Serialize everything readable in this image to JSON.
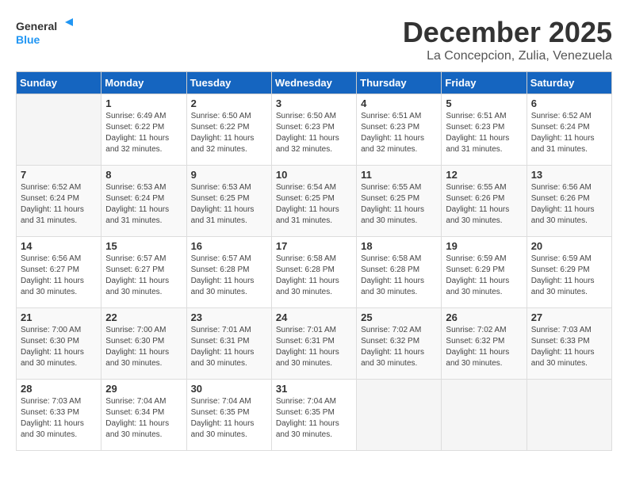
{
  "header": {
    "logo_general": "General",
    "logo_blue": "Blue",
    "month": "December 2025",
    "location": "La Concepcion, Zulia, Venezuela"
  },
  "days_of_week": [
    "Sunday",
    "Monday",
    "Tuesday",
    "Wednesday",
    "Thursday",
    "Friday",
    "Saturday"
  ],
  "weeks": [
    [
      {
        "day": "",
        "info": ""
      },
      {
        "day": "1",
        "info": "Sunrise: 6:49 AM\nSunset: 6:22 PM\nDaylight: 11 hours and 32 minutes."
      },
      {
        "day": "2",
        "info": "Sunrise: 6:50 AM\nSunset: 6:22 PM\nDaylight: 11 hours and 32 minutes."
      },
      {
        "day": "3",
        "info": "Sunrise: 6:50 AM\nSunset: 6:23 PM\nDaylight: 11 hours and 32 minutes."
      },
      {
        "day": "4",
        "info": "Sunrise: 6:51 AM\nSunset: 6:23 PM\nDaylight: 11 hours and 32 minutes."
      },
      {
        "day": "5",
        "info": "Sunrise: 6:51 AM\nSunset: 6:23 PM\nDaylight: 11 hours and 31 minutes."
      },
      {
        "day": "6",
        "info": "Sunrise: 6:52 AM\nSunset: 6:24 PM\nDaylight: 11 hours and 31 minutes."
      }
    ],
    [
      {
        "day": "7",
        "info": "Sunrise: 6:52 AM\nSunset: 6:24 PM\nDaylight: 11 hours and 31 minutes."
      },
      {
        "day": "8",
        "info": "Sunrise: 6:53 AM\nSunset: 6:24 PM\nDaylight: 11 hours and 31 minutes."
      },
      {
        "day": "9",
        "info": "Sunrise: 6:53 AM\nSunset: 6:25 PM\nDaylight: 11 hours and 31 minutes."
      },
      {
        "day": "10",
        "info": "Sunrise: 6:54 AM\nSunset: 6:25 PM\nDaylight: 11 hours and 31 minutes."
      },
      {
        "day": "11",
        "info": "Sunrise: 6:55 AM\nSunset: 6:25 PM\nDaylight: 11 hours and 30 minutes."
      },
      {
        "day": "12",
        "info": "Sunrise: 6:55 AM\nSunset: 6:26 PM\nDaylight: 11 hours and 30 minutes."
      },
      {
        "day": "13",
        "info": "Sunrise: 6:56 AM\nSunset: 6:26 PM\nDaylight: 11 hours and 30 minutes."
      }
    ],
    [
      {
        "day": "14",
        "info": "Sunrise: 6:56 AM\nSunset: 6:27 PM\nDaylight: 11 hours and 30 minutes."
      },
      {
        "day": "15",
        "info": "Sunrise: 6:57 AM\nSunset: 6:27 PM\nDaylight: 11 hours and 30 minutes."
      },
      {
        "day": "16",
        "info": "Sunrise: 6:57 AM\nSunset: 6:28 PM\nDaylight: 11 hours and 30 minutes."
      },
      {
        "day": "17",
        "info": "Sunrise: 6:58 AM\nSunset: 6:28 PM\nDaylight: 11 hours and 30 minutes."
      },
      {
        "day": "18",
        "info": "Sunrise: 6:58 AM\nSunset: 6:28 PM\nDaylight: 11 hours and 30 minutes."
      },
      {
        "day": "19",
        "info": "Sunrise: 6:59 AM\nSunset: 6:29 PM\nDaylight: 11 hours and 30 minutes."
      },
      {
        "day": "20",
        "info": "Sunrise: 6:59 AM\nSunset: 6:29 PM\nDaylight: 11 hours and 30 minutes."
      }
    ],
    [
      {
        "day": "21",
        "info": "Sunrise: 7:00 AM\nSunset: 6:30 PM\nDaylight: 11 hours and 30 minutes."
      },
      {
        "day": "22",
        "info": "Sunrise: 7:00 AM\nSunset: 6:30 PM\nDaylight: 11 hours and 30 minutes."
      },
      {
        "day": "23",
        "info": "Sunrise: 7:01 AM\nSunset: 6:31 PM\nDaylight: 11 hours and 30 minutes."
      },
      {
        "day": "24",
        "info": "Sunrise: 7:01 AM\nSunset: 6:31 PM\nDaylight: 11 hours and 30 minutes."
      },
      {
        "day": "25",
        "info": "Sunrise: 7:02 AM\nSunset: 6:32 PM\nDaylight: 11 hours and 30 minutes."
      },
      {
        "day": "26",
        "info": "Sunrise: 7:02 AM\nSunset: 6:32 PM\nDaylight: 11 hours and 30 minutes."
      },
      {
        "day": "27",
        "info": "Sunrise: 7:03 AM\nSunset: 6:33 PM\nDaylight: 11 hours and 30 minutes."
      }
    ],
    [
      {
        "day": "28",
        "info": "Sunrise: 7:03 AM\nSunset: 6:33 PM\nDaylight: 11 hours and 30 minutes."
      },
      {
        "day": "29",
        "info": "Sunrise: 7:04 AM\nSunset: 6:34 PM\nDaylight: 11 hours and 30 minutes."
      },
      {
        "day": "30",
        "info": "Sunrise: 7:04 AM\nSunset: 6:35 PM\nDaylight: 11 hours and 30 minutes."
      },
      {
        "day": "31",
        "info": "Sunrise: 7:04 AM\nSunset: 6:35 PM\nDaylight: 11 hours and 30 minutes."
      },
      {
        "day": "",
        "info": ""
      },
      {
        "day": "",
        "info": ""
      },
      {
        "day": "",
        "info": ""
      }
    ]
  ]
}
